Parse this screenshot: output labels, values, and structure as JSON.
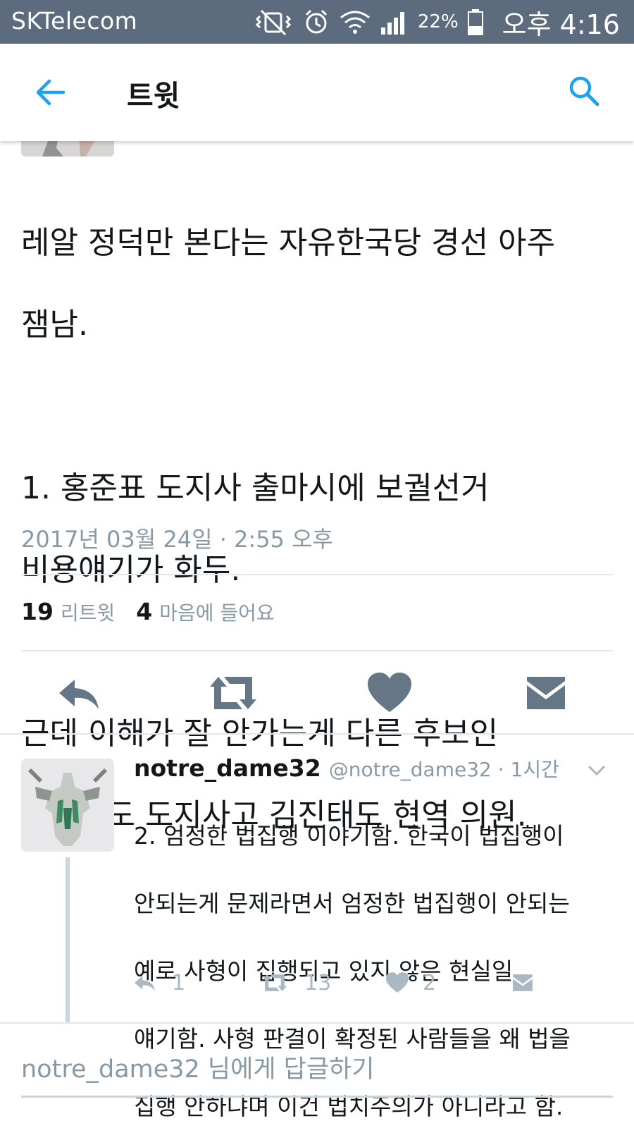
{
  "status_bar": {
    "carrier": "SKTelecom",
    "battery": "22%",
    "time": "오후 4:16",
    "icons": [
      "mute-vibrate-icon",
      "alarm-icon",
      "wifi-icon",
      "signal-icon",
      "battery-icon"
    ]
  },
  "header": {
    "title": "트윗",
    "accent_color": "#1da1f2",
    "icons": [
      "back-arrow-icon",
      "search-icon"
    ]
  },
  "tweet": {
    "text": "레알 정덕만 본다는 자유한국당 경선 아주 잼남.\n\n1. 홍준표 도지사 출마시에 보궐선거 비용얘기가 화두.\n\n근데 이해가 잘 안가는게 다른 후보인 김관용도 도지사고 김진태도 현역 의원.",
    "text_lines": [
      "레알 정덕만 본다는 자유한국당 경선 아주",
      "잼남.",
      "",
      "1. 홍준표 도지사 출마시에 보궐선거",
      "비용얘기가 화두.",
      "",
      "근데 이해가 잘 안가는게 다른 후보인",
      "김관용도 도지사고 김진태도 현역 의원."
    ],
    "timestamp": "2017년 03월 24일 · 2:55 오후",
    "retweet_count": "19",
    "retweet_label": "리트윗",
    "like_count": "4",
    "like_label": "마음에 들어요",
    "action_icons": [
      "reply-icon",
      "retweet-icon",
      "heart-icon",
      "message-icon"
    ]
  },
  "reply": {
    "name": "notre_dame32",
    "handle_time": "@notre_dame32 · 1시간",
    "lines": [
      "2. 엄정한 법집행 이야기함. 한국이 법집행이",
      "안되는게 문제라면서 엄정한 법집행이 안되는",
      "예로 사형이 집행되고 있지 않은 현실일",
      "얘기함. 사형 판결이 확정된 사람들을 왜 법을",
      "집행 안하냐며 이건 법치주의가 아니라고 함."
    ],
    "reply_count": "1",
    "retweet_count": "13",
    "like_count": "2"
  },
  "reply_box": {
    "placeholder": "notre_dame32 님에게 답글하기"
  }
}
